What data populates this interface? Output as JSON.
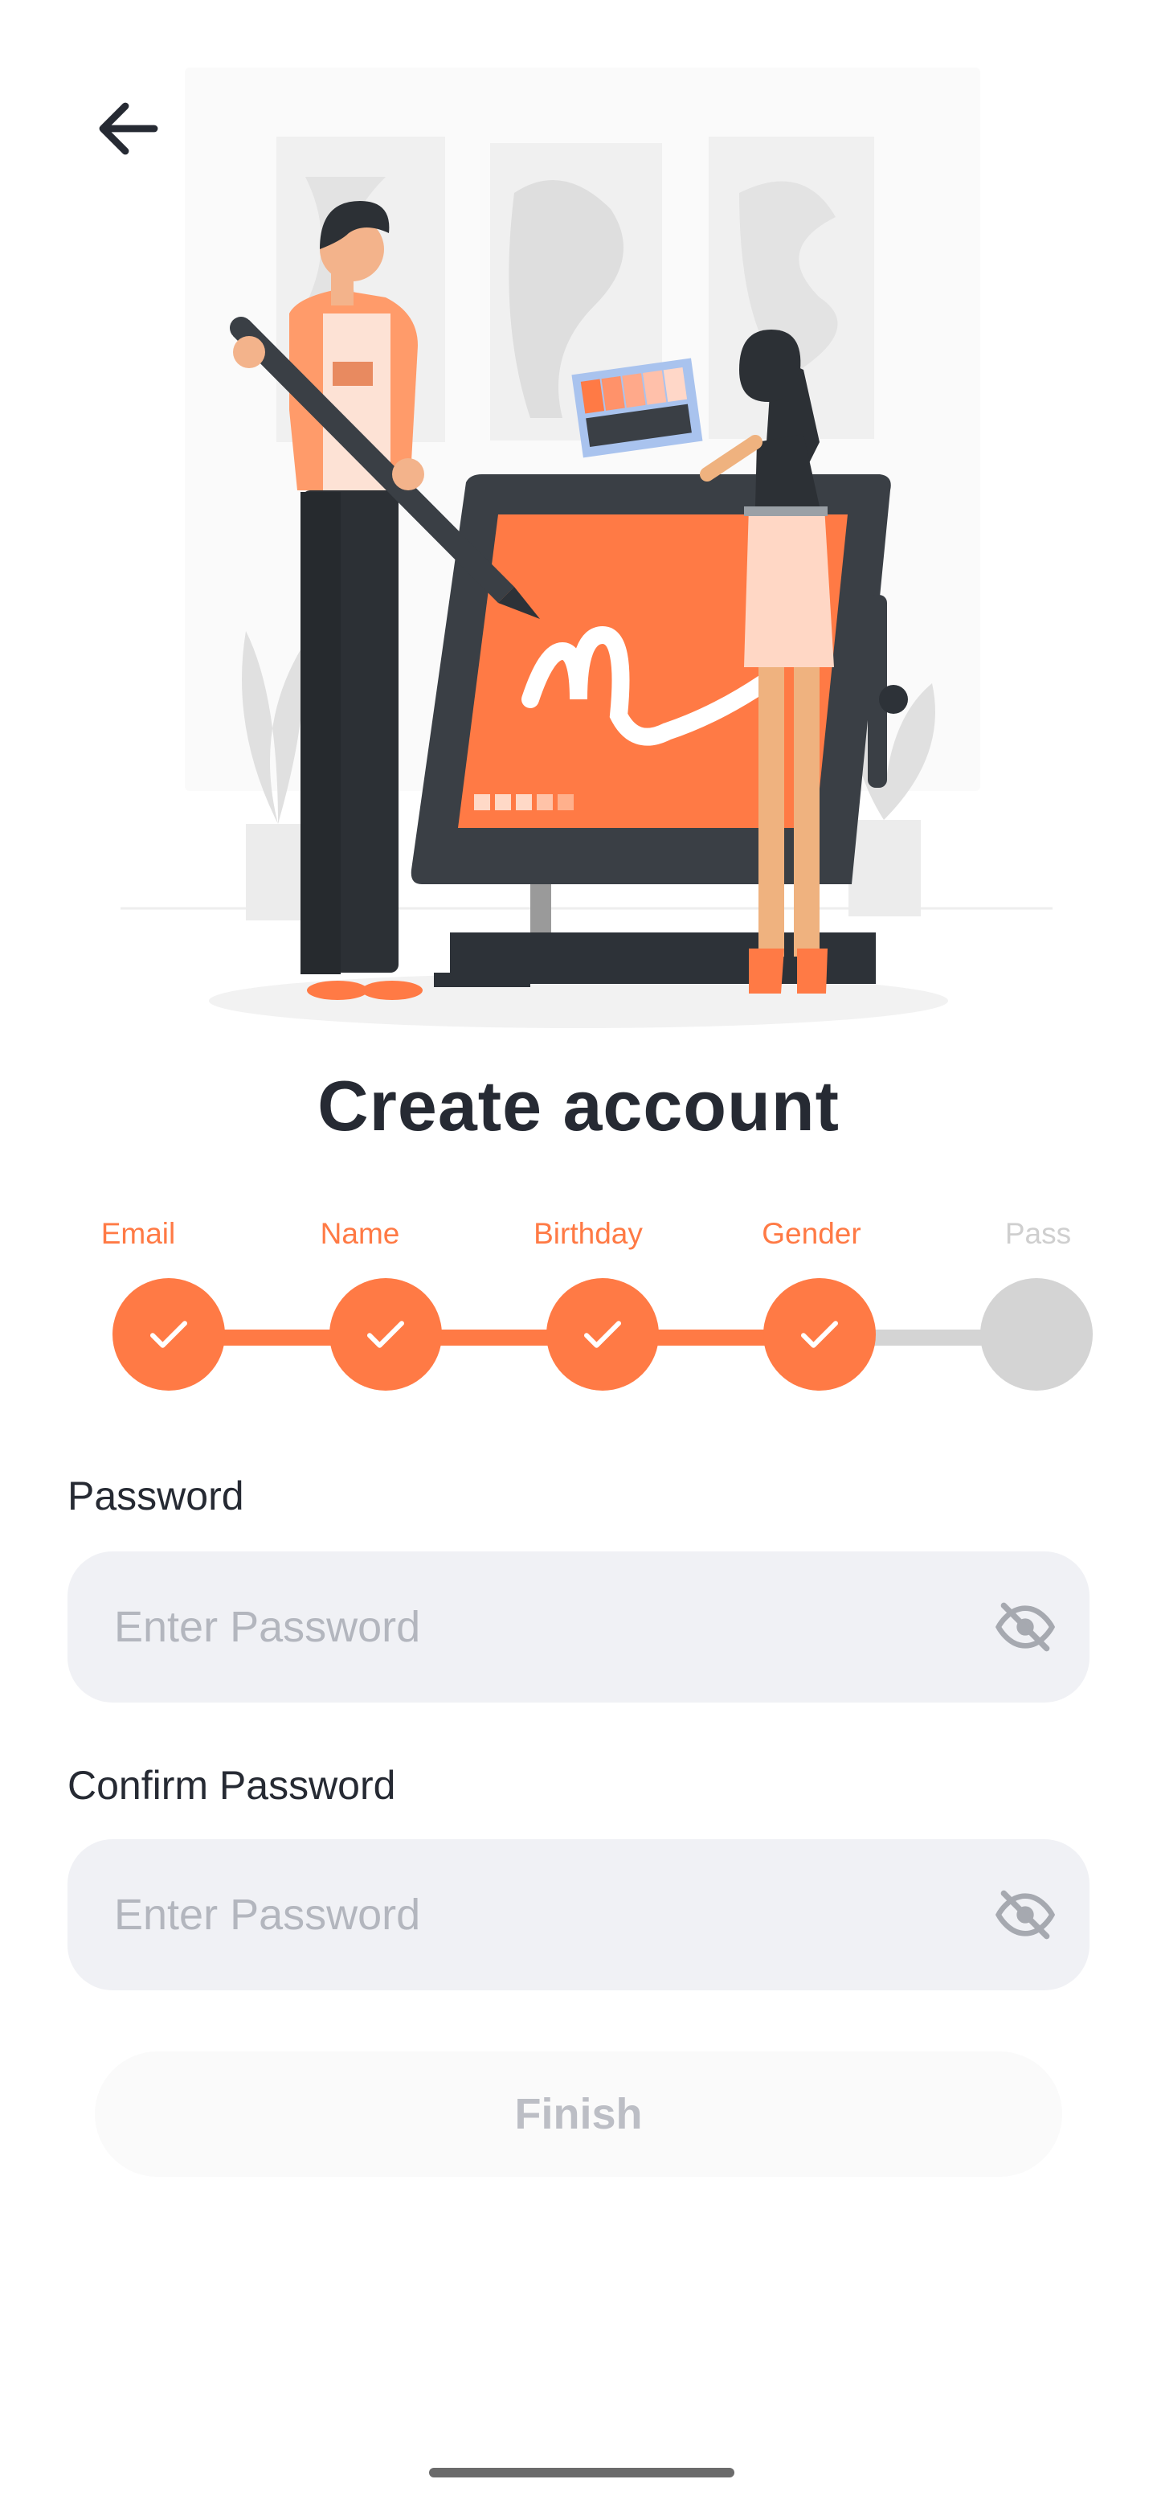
{
  "header": {
    "title": "Create account",
    "back_icon": "arrow-left-icon"
  },
  "stepper": {
    "steps": [
      {
        "label": "Email",
        "done": true
      },
      {
        "label": "Name",
        "done": true
      },
      {
        "label": "Birthday",
        "done": true
      },
      {
        "label": "Gender",
        "done": true
      },
      {
        "label": "Pass",
        "done": false
      }
    ],
    "accent_color": "#FF7A45",
    "pending_color": "#D4D4D4"
  },
  "form": {
    "password": {
      "label": "Password",
      "placeholder": "Enter Password",
      "value": ""
    },
    "confirm": {
      "label": "Confirm Password",
      "placeholder": "Enter Password",
      "value": ""
    }
  },
  "actions": {
    "finish_label": "Finish"
  }
}
